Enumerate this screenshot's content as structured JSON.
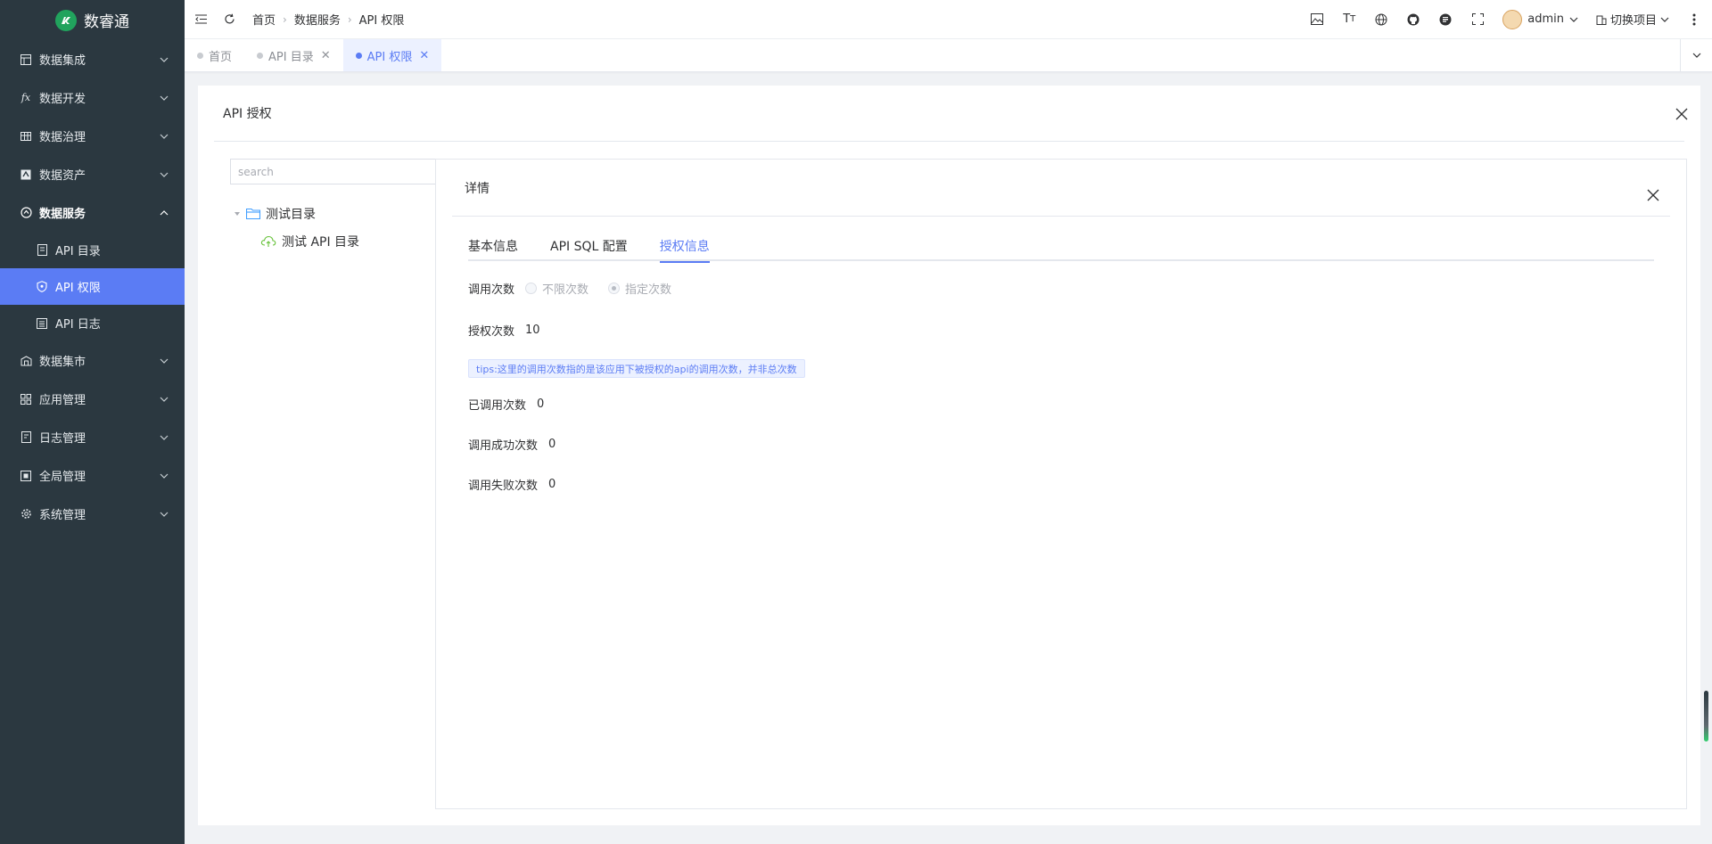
{
  "app": {
    "name": "数睿通"
  },
  "sidebar": {
    "items": [
      {
        "label": "数据集成",
        "icon": "grid-icon"
      },
      {
        "label": "数据开发",
        "icon": "fx-icon"
      },
      {
        "label": "数据治理",
        "icon": "table-icon"
      },
      {
        "label": "数据资产",
        "icon": "asset-icon"
      },
      {
        "label": "数据服务",
        "icon": "service-icon"
      },
      {
        "label": "数据集市",
        "icon": "market-icon"
      },
      {
        "label": "应用管理",
        "icon": "apps-icon"
      },
      {
        "label": "日志管理",
        "icon": "log-icon"
      },
      {
        "label": "全局管理",
        "icon": "global-icon"
      },
      {
        "label": "系统管理",
        "icon": "gear-icon"
      }
    ],
    "sub_items": [
      {
        "label": "API 目录"
      },
      {
        "label": "API 权限"
      },
      {
        "label": "API 日志"
      }
    ]
  },
  "topbar": {
    "breadcrumbs": [
      "首页",
      "数据服务",
      "API 权限"
    ],
    "user": "admin",
    "project_switch": "切换项目"
  },
  "tabs": [
    {
      "label": "首页"
    },
    {
      "label": "API 目录"
    },
    {
      "label": "API 权限"
    }
  ],
  "card": {
    "title": "API 授权",
    "search_placeholder": "search",
    "tree": {
      "folder": "测试目录",
      "leaf": "测试 API 目录"
    }
  },
  "detail": {
    "title": "详情",
    "tabs": [
      "基本信息",
      "API SQL 配置",
      "授权信息"
    ],
    "call_limit_label": "调用次数",
    "radio_unlimited": "不限次数",
    "radio_specified": "指定次数",
    "auth_count_label": "授权次数",
    "auth_count_value": "10",
    "tips": "tips:这里的调用次数指的是该应用下被授权的api的调用次数，并非总次数",
    "called_label": "已调用次数",
    "called_value": "0",
    "success_label": "调用成功次数",
    "success_value": "0",
    "fail_label": "调用失败次数",
    "fail_value": "0"
  },
  "colors": {
    "accent": "#5b7cf4",
    "sidebar_bg": "#2b3840",
    "logo_green": "#21a35d"
  }
}
